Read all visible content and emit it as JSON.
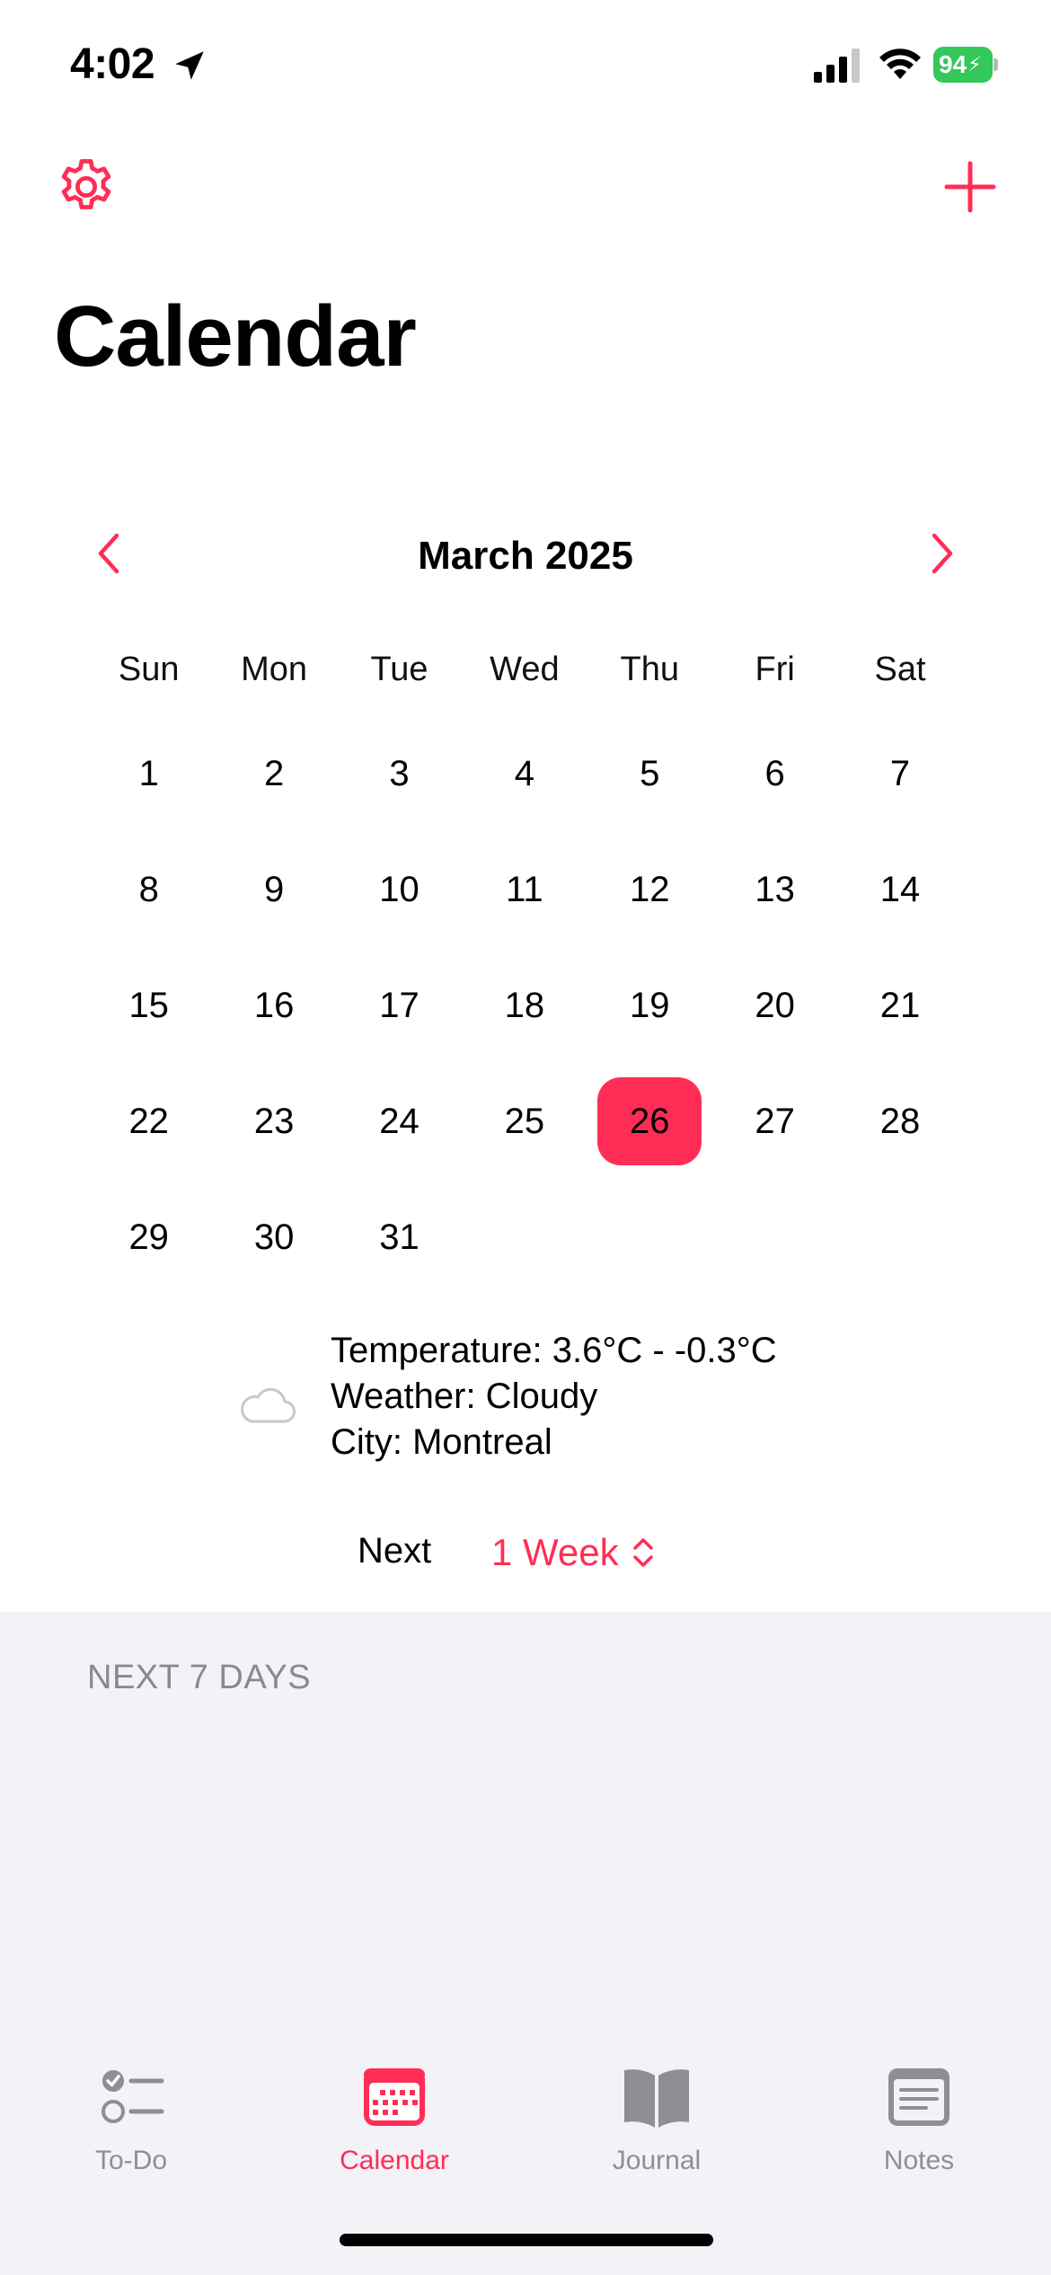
{
  "status_bar": {
    "time": "4:02",
    "battery": "94"
  },
  "nav": {
    "title": "Calendar",
    "settings_icon": "gear-icon",
    "add_icon": "plus-icon"
  },
  "calendar": {
    "month_label": "March 2025",
    "weekdays": [
      "Sun",
      "Mon",
      "Tue",
      "Wed",
      "Thu",
      "Fri",
      "Sat"
    ],
    "weeks": [
      [
        "1",
        "2",
        "3",
        "4",
        "5",
        "6",
        "7"
      ],
      [
        "8",
        "9",
        "10",
        "11",
        "12",
        "13",
        "14"
      ],
      [
        "15",
        "16",
        "17",
        "18",
        "19",
        "20",
        "21"
      ],
      [
        "22",
        "23",
        "24",
        "25",
        "26",
        "27",
        "28"
      ],
      [
        "29",
        "30",
        "31",
        "",
        "",
        "",
        ""
      ]
    ],
    "selected_day": "26"
  },
  "weather": {
    "icon": "cloud-icon",
    "temperature": "Temperature: 3.6°C - -0.3°C",
    "condition": "Weather: Cloudy",
    "city": "City: Montreal"
  },
  "range": {
    "label": "Next",
    "value": "1 Week"
  },
  "list": {
    "section_header": "NEXT 7 DAYS"
  },
  "tabs": [
    {
      "label": "To-Do",
      "icon": "checklist-icon",
      "active": false
    },
    {
      "label": "Calendar",
      "icon": "calendar-icon",
      "active": true
    },
    {
      "label": "Journal",
      "icon": "book-icon",
      "active": false
    },
    {
      "label": "Notes",
      "icon": "notes-icon",
      "active": false
    }
  ],
  "colors": {
    "accent": "#ff2d55",
    "grouped_background": "#f2f2f7",
    "inactive_tab": "#8e8e93",
    "battery": "#34c759"
  }
}
